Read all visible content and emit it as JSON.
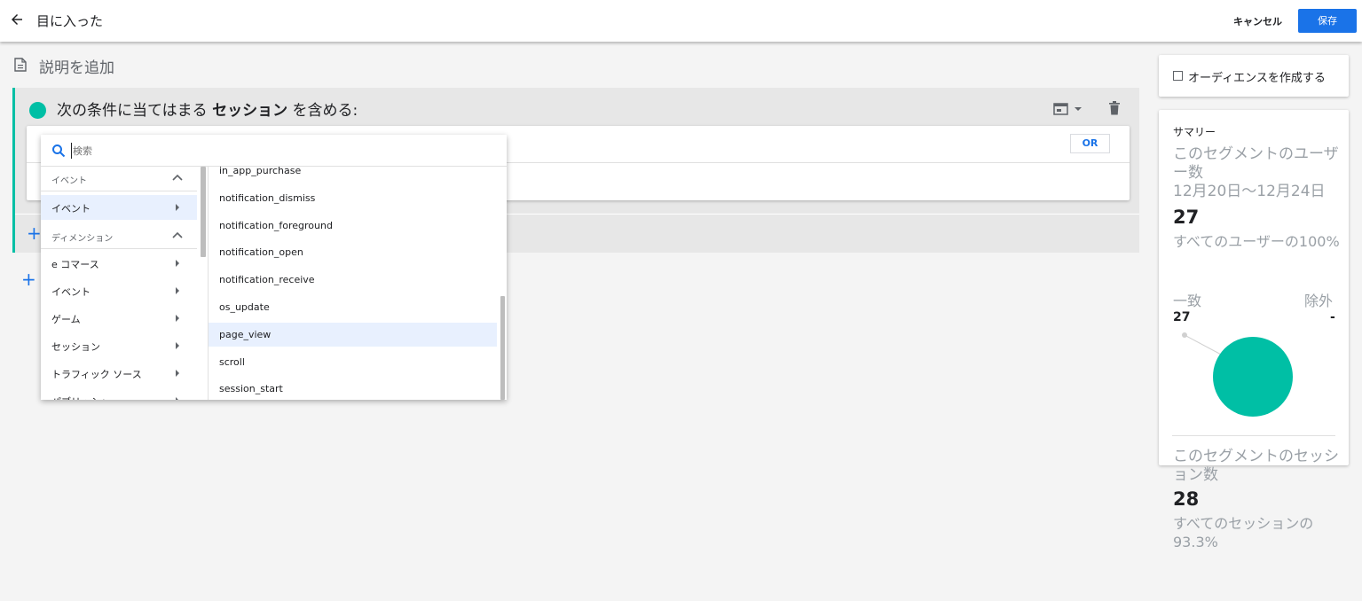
{
  "header": {
    "title": "目に入った",
    "cancel_label": "キャンセル",
    "save_label": "保存"
  },
  "description": {
    "label": "説明を追加"
  },
  "condition": {
    "prefix": "次の条件に当てはまる ",
    "scope": "セッション",
    "suffix": " を含める:",
    "or_label": "OR",
    "accent_color": "#00bfa5"
  },
  "dropdown": {
    "search_placeholder": "検索",
    "categories": [
      {
        "label": "イベント",
        "type": "header"
      },
      {
        "label": "イベント",
        "type": "item",
        "selected": true
      },
      {
        "label": "ディメンション",
        "type": "header"
      },
      {
        "label": "e コマース",
        "type": "item"
      },
      {
        "label": "イベント",
        "type": "item"
      },
      {
        "label": "ゲーム",
        "type": "item"
      },
      {
        "label": "セッション",
        "type": "item"
      },
      {
        "label": "トラフィック ソース",
        "type": "item"
      },
      {
        "label": "パブリッシャー",
        "type": "item"
      }
    ],
    "events": [
      "in_app_purchase",
      "notification_dismiss",
      "notification_foreground",
      "notification_open",
      "notification_receive",
      "os_update",
      "page_view",
      "scroll",
      "session_start"
    ],
    "selected_event": "page_view"
  },
  "audience": {
    "label": "オーディエンスを作成する",
    "checked": false
  },
  "summary": {
    "title": "サマリー",
    "users_label": "このセグメントのユーザー数",
    "date_range": "12月20日〜12月24日",
    "users_value": "27",
    "users_pct": "すべてのユーザーの100%",
    "match_label": "一致",
    "exclude_label": "除外",
    "match_value": "27",
    "exclude_value": "-",
    "match_fraction": 1.0,
    "sessions_label": "このセグメントのセッション数",
    "sessions_value": "28",
    "sessions_pct": "すべてのセッションの93.3%",
    "pie_color": "#00bfa5"
  }
}
